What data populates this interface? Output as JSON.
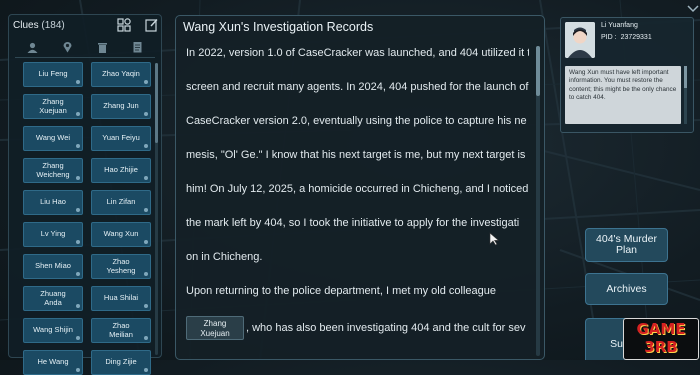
{
  "clues": {
    "title": "Clues",
    "count": "(184)",
    "items": [
      [
        "Liu Feng",
        "Zhao Yaqin"
      ],
      [
        "Zhang\nXuejuan",
        "Zhang Jun"
      ],
      [
        "Wang Wei",
        "Yuan Feiyu"
      ],
      [
        "Zhang\nWeicheng",
        "Hao Zhijie"
      ],
      [
        "Liu Hao",
        "Lin Zifan"
      ],
      [
        "Lv Ying",
        "Wang Xun"
      ],
      [
        "Shen Miao",
        "Zhao\nYesheng"
      ],
      [
        "Zhuang\nAnda",
        "Hua Shilai"
      ],
      [
        "Wang Shijin",
        "Zhao\nMeilian"
      ],
      [
        "He Wang",
        "Ding Zijie"
      ]
    ],
    "icons": {
      "grid": "category-grid-icon",
      "edit": "edit-note-icon",
      "filters": [
        "person-filter-icon",
        "location-filter-icon",
        "trash-filter-icon",
        "document-filter-icon"
      ]
    }
  },
  "records": {
    "title": "Wang Xun's Investigation Records",
    "lines": [
      "In 2022, version 1.0 of CaseCracker was launched, and 404 utilized it to",
      " screen and recruit many agents. In 2024, 404 pushed for the launch of",
      "CaseCracker version 2.0, eventually using the police to capture his ne",
      "mesis, \"Ol' Ge.\" I know that his next target is me, but my next target is",
      "him! On July 12, 2025, a homicide occurred in Chicheng, and I noticed",
      "the mark left by 404, so I took the initiative to apply for the investigati",
      "on in Chicheng.",
      "",
      "Upon returning to the police department, I met my old colleague"
    ],
    "inline_chip": "Zhang\nXuejuan",
    "last_line": ", who has also been investigating 404 and the cult for sev"
  },
  "contact": {
    "name": "Li Yuanfang",
    "pid_label": "PID :",
    "pid": "23729331",
    "message": "Wang Xun must have left important information. You must restore the content; this might be the only chance to catch 404."
  },
  "side_buttons": {
    "murder_plan": "404's Murder\nPlan",
    "archives": "Archives",
    "submit": "Submit"
  },
  "watermark": {
    "line1": "GAME",
    "line2": "3RB"
  },
  "colors": {
    "card_bg": "#1b4a63",
    "panel_bg": "#14202a",
    "accent": "#3d7390",
    "watermark_red": "#d42121"
  }
}
